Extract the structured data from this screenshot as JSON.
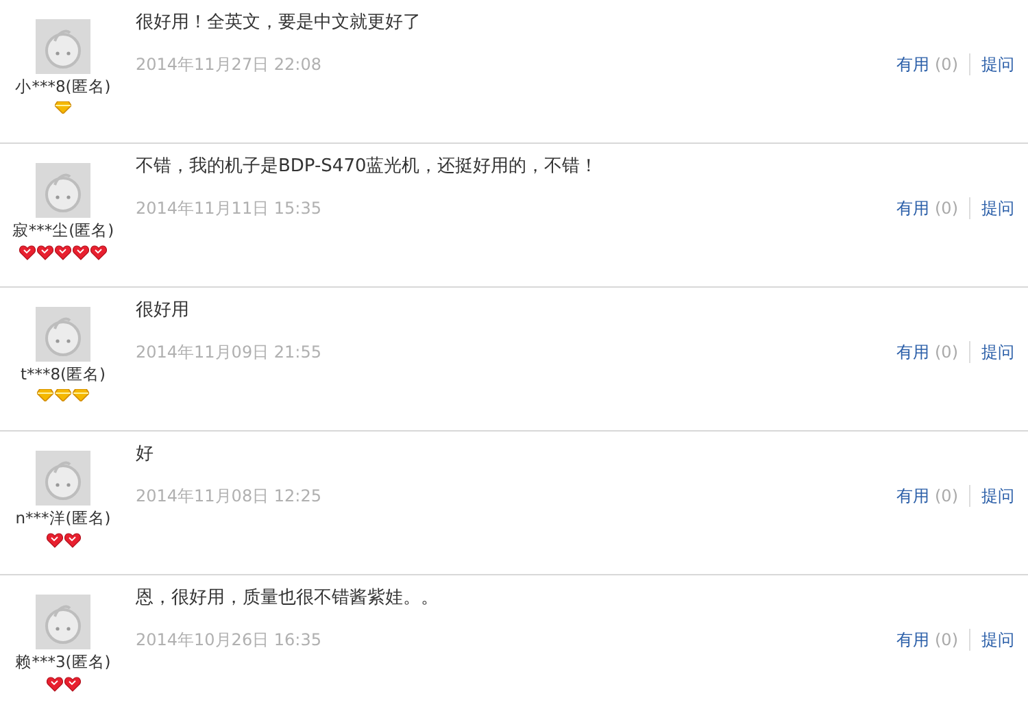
{
  "reviews": [
    {
      "user": "小***8(匿名)",
      "rank_icons": [
        {
          "kind": "diamond"
        }
      ],
      "comment": "很好用！全英文，要是中文就更好了",
      "date": "2014年11月27日 22:08",
      "useful_label": "有用",
      "useful_count": "(0)",
      "ask_label": "提问"
    },
    {
      "user": "寂***尘(匿名)",
      "rank_icons": [
        {
          "kind": "heart"
        },
        {
          "kind": "heart"
        },
        {
          "kind": "heart"
        },
        {
          "kind": "heart"
        },
        {
          "kind": "heart"
        }
      ],
      "comment": "不错，我的机子是BDP-S470蓝光机，还挺好用的，不错！",
      "date": "2014年11月11日 15:35",
      "useful_label": "有用",
      "useful_count": "(0)",
      "ask_label": "提问"
    },
    {
      "user": "t***8(匿名)",
      "rank_icons": [
        {
          "kind": "diamond"
        },
        {
          "kind": "diamond"
        },
        {
          "kind": "diamond"
        }
      ],
      "comment": "很好用",
      "date": "2014年11月09日 21:55",
      "useful_label": "有用",
      "useful_count": "(0)",
      "ask_label": "提问"
    },
    {
      "user": "n***洋(匿名)",
      "rank_icons": [
        {
          "kind": "heart"
        },
        {
          "kind": "heart"
        }
      ],
      "comment": "好",
      "date": "2014年11月08日 12:25",
      "useful_label": "有用",
      "useful_count": "(0)",
      "ask_label": "提问"
    },
    {
      "user": "赖***3(匿名)",
      "rank_icons": [
        {
          "kind": "heart"
        },
        {
          "kind": "heart"
        }
      ],
      "comment": "恩，很好用，质量也很不错酱紫娃。。",
      "date": "2014年10月26日 16:35",
      "useful_label": "有用",
      "useful_count": "(0)",
      "ask_label": "提问"
    }
  ]
}
